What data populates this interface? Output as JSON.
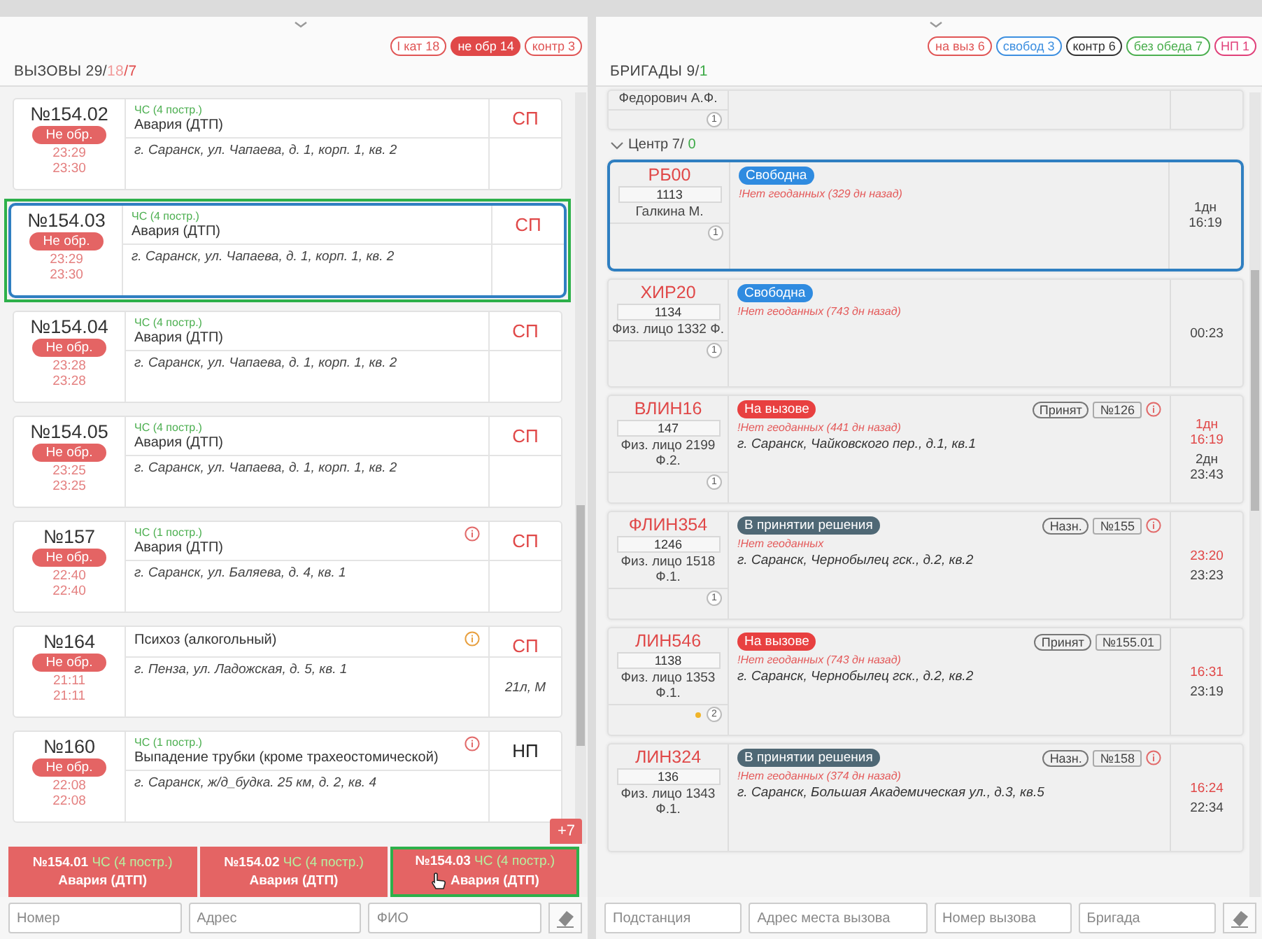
{
  "calls_panel": {
    "filters": [
      {
        "text": "I кат 18",
        "color": "#e05555",
        "filled": false
      },
      {
        "text": "не обр 14",
        "color": "#e04848",
        "filled": true
      },
      {
        "text": "контр 3",
        "color": "#e05555",
        "filled": false
      }
    ],
    "title": [
      {
        "text": "ВЫЗОВЫ 29/",
        "color": "#444444"
      },
      {
        "text": "18",
        "color": "#f19a9a"
      },
      {
        "text": "/7",
        "color": "#e04848"
      }
    ],
    "calls": [
      {
        "number": "№154.02",
        "status": "Не обр.",
        "times": [
          "23:29",
          "23:30"
        ],
        "category": "ЧС (4 постр.)",
        "reason": "Авария (ДТП)",
        "address": "г. Саранск, ул. Чапаева, д. 1, корп. 1, кв. 2",
        "priority": "СП",
        "urgent": true,
        "selected": false,
        "highlighted": false
      },
      {
        "number": "№154.03",
        "status": "Не обр.",
        "times": [
          "23:29",
          "23:30"
        ],
        "category": "ЧС (4 постр.)",
        "reason": "Авария (ДТП)",
        "address": "г. Саранск, ул. Чапаева, д. 1, корп. 1, кв. 2",
        "priority": "СП",
        "urgent": true,
        "selected": true,
        "highlighted": true
      },
      {
        "number": "№154.04",
        "status": "Не обр.",
        "times": [
          "23:28",
          "23:28"
        ],
        "category": "ЧС (4 постр.)",
        "reason": "Авария (ДТП)",
        "address": "г. Саранск, ул. Чапаева, д. 1, корп. 1, кв. 2",
        "priority": "СП",
        "urgent": true,
        "selected": false,
        "highlighted": false
      },
      {
        "number": "№154.05",
        "status": "Не обр.",
        "times": [
          "23:25",
          "23:25"
        ],
        "category": "ЧС (4 постр.)",
        "reason": "Авария (ДТП)",
        "address": "г. Саранск, ул. Чапаева, д. 1, корп. 1, кв. 2",
        "priority": "СП",
        "urgent": true,
        "selected": false,
        "highlighted": false
      },
      {
        "number": "№157",
        "status": "Не обр.",
        "times": [
          "22:40",
          "22:40"
        ],
        "category": "ЧС (1 постр.)",
        "reason": "Авария (ДТП)",
        "address": "г. Саранск, ул. Баляева, д. 4, кв. 1",
        "priority": "СП",
        "urgent": true,
        "info_icon": {
          "color": "#e26a6a"
        },
        "selected": false,
        "highlighted": false
      },
      {
        "number": "№164",
        "status": "Не обр.",
        "times": [
          "21:11",
          "21:11"
        ],
        "reason": "Психоз (алкогольный)",
        "address": "г. Пенза, ул. Ладожская, д. 5, кв. 1",
        "priority": "СП",
        "urgent": true,
        "extra": "21л, М",
        "info_icon": {
          "color": "#e8a040"
        },
        "selected": false,
        "highlighted": false
      },
      {
        "number": "№160",
        "status": "Не обр.",
        "times": [
          "22:08",
          "22:08"
        ],
        "category": "ЧС (1 постр.)",
        "reason": "Выпадение трубки (кроме трахеостомической)",
        "address": "г. Саранск, ж/д_будка. 25 км, д. 2, кв. 4",
        "priority": "НП",
        "urgent": false,
        "info_icon": {
          "color": "#e26a6a"
        },
        "selected": false,
        "highlighted": false
      }
    ],
    "more_badge": "+7",
    "tiles": [
      {
        "number": "№154.01",
        "category": "ЧС (4 постр.)",
        "reason": "Авария (ДТП)",
        "highlighted": false,
        "pointer": false
      },
      {
        "number": "№154.02",
        "category": "ЧС (4 постр.)",
        "reason": "Авария (ДТП)",
        "highlighted": false,
        "pointer": false
      },
      {
        "number": "№154.03",
        "category": "ЧС (4 постр.)",
        "reason": "Авария (ДТП)",
        "highlighted": true,
        "pointer": true
      }
    ],
    "search_fields": [
      {
        "placeholder": "Номер"
      },
      {
        "placeholder": "Адрес"
      },
      {
        "placeholder": "ФИО"
      }
    ]
  },
  "teams_panel": {
    "filters": [
      {
        "text": "на выз 6",
        "color": "#e05555",
        "filled": false
      },
      {
        "text": "свобод 3",
        "color": "#3d8fe0",
        "filled": false
      },
      {
        "text": "контр 6",
        "color": "#333333",
        "filled": false
      },
      {
        "text": "без обеда 7",
        "color": "#4caf50",
        "filled": false
      },
      {
        "text": "НП 1",
        "color": "#e0407a",
        "filled": false
      }
    ],
    "title": [
      {
        "text": "БРИГАДЫ 9/",
        "color": "#444444"
      },
      {
        "text": "1",
        "color": "#3aa844"
      }
    ],
    "previous_team": {
      "name": "Федорович А.Ф.",
      "count": "1"
    },
    "group": {
      "name": "Центр 7/",
      "free": "0",
      "expanded": true
    },
    "teams": [
      {
        "code": "РБ00",
        "unit": "1113",
        "name": "Галкина М.",
        "count": "1",
        "status": {
          "kind": "free",
          "text": "Свободна"
        },
        "geo": "!Нет геоданных (329 дн назад)",
        "times": [
          {
            "lines": [
              "1дн",
              "16:19"
            ],
            "overdue": false
          }
        ],
        "selected": true
      },
      {
        "code": "ХИР20",
        "unit": "1134",
        "name": "Физ. лицо 1332 Ф.",
        "count": "1",
        "status": {
          "kind": "free",
          "text": "Свободна"
        },
        "geo": "!Нет геоданных (743 дн назад)",
        "times": [
          {
            "lines": [
              "00:23"
            ],
            "overdue": false
          }
        ],
        "selected": false
      },
      {
        "code": "ВЛИН16",
        "unit": "147",
        "name": "Физ. лицо 2199 Ф.2.",
        "count": "1",
        "status": {
          "kind": "on_call",
          "text": "На вызове"
        },
        "tags": [
          {
            "kind": "pill",
            "text": "Принят"
          },
          {
            "kind": "box",
            "text": "№126"
          }
        ],
        "alert": true,
        "geo": "!Нет геоданных (441 дн назад)",
        "address": "г. Саранск, Чайковского пер., д.1, кв.1",
        "times": [
          {
            "lines": [
              "1дн",
              "16:19"
            ],
            "overdue": true
          },
          {
            "lines": [
              "2дн",
              "23:43"
            ],
            "overdue": false
          }
        ],
        "selected": false
      },
      {
        "code": "ФЛИН354",
        "unit": "1246",
        "name": "Физ. лицо 1518 Ф.1.",
        "count": "1",
        "status": {
          "kind": "deciding",
          "text": "В принятии решения"
        },
        "tags": [
          {
            "kind": "pill",
            "text": "Назн."
          },
          {
            "kind": "box",
            "text": "№155"
          }
        ],
        "alert": true,
        "geo": "!Нет геоданных",
        "address": "г. Саранск, Чернобылец гск., д.2, кв.2",
        "times": [
          {
            "lines": [
              "23:20"
            ],
            "overdue": true
          },
          {
            "lines": [
              "23:23"
            ],
            "overdue": false
          }
        ],
        "selected": false
      },
      {
        "code": "ЛИН546",
        "unit": "1138",
        "name": "Физ. лицо 1353 Ф.1.",
        "count": "2",
        "dot": {
          "color": "#f0b429"
        },
        "status": {
          "kind": "on_call",
          "text": "На вызове"
        },
        "tags": [
          {
            "kind": "pill",
            "text": "Принят"
          },
          {
            "kind": "box",
            "text": "№155.01"
          }
        ],
        "alert": false,
        "geo": "!Нет геоданных (743 дн назад)",
        "address": "г. Саранск, Чернобылец гск., д.2, кв.2",
        "times": [
          {
            "lines": [
              "16:31"
            ],
            "overdue": true
          },
          {
            "lines": [
              "23:19"
            ],
            "overdue": false
          }
        ],
        "selected": false
      },
      {
        "code": "ЛИН324",
        "unit": "136",
        "name": "Физ. лицо 1343 Ф.1.",
        "status": {
          "kind": "deciding",
          "text": "В принятии решения"
        },
        "tags": [
          {
            "kind": "pill",
            "text": "Назн."
          },
          {
            "kind": "box",
            "text": "№158"
          }
        ],
        "alert": true,
        "geo": "!Нет геоданных (374 дн назад)",
        "address": "г. Саранск, Большая Академическая ул., д.3, кв.5",
        "times": [
          {
            "lines": [
              "16:24"
            ],
            "overdue": true
          },
          {
            "lines": [
              "22:34"
            ],
            "overdue": false
          }
        ],
        "selected": false
      }
    ],
    "search_fields": [
      {
        "placeholder": "Подстанция"
      },
      {
        "placeholder": "Адрес места вызова"
      },
      {
        "placeholder": "Номер вызова"
      },
      {
        "placeholder": "Бригада"
      }
    ]
  }
}
